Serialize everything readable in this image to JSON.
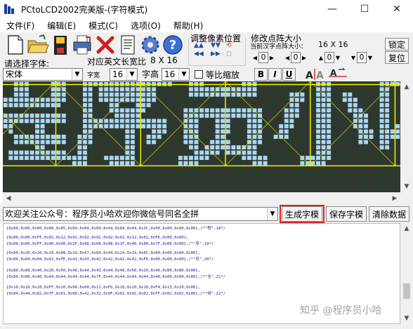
{
  "window": {
    "title": "PCtoLCD2002完美版-(字符模式)",
    "minimize": "—",
    "maximize": "☐",
    "close": "✕"
  },
  "menu": [
    "文件(F)",
    "编辑(E)",
    "模式(C)",
    "选项(O)",
    "帮助(H)"
  ],
  "toolbar": {
    "icons": [
      "new-file-icon",
      "open-folder-icon",
      "save-disk-icon",
      "print-icon",
      "delete-icon",
      "document-icon",
      "gear-icon",
      "help-icon"
    ],
    "adjust_label": "调整像素位置",
    "modify_label": "修改点阵大小",
    "current_size_label": "当前汉字点阵大小：",
    "current_size_value": "16 X 16",
    "lock_label": "锁定",
    "restore_label": "复位",
    "spin_values": [
      "0",
      "0",
      "0",
      "0"
    ],
    "select_font_label": "请选择字体:",
    "font_value": "宋体",
    "en_width_label": "对应英文长宽比",
    "en_width_value": "8 X 16",
    "char_width_label": "字宽",
    "char_width_value": "16",
    "char_height_label": "字高",
    "char_height_value": "16",
    "proportional_label": "等比缩放",
    "bold_label": "B",
    "italic_label": "I",
    "underline_label": "U"
  },
  "matrix": {
    "cols": 75,
    "rows": 21,
    "text": "程序员小哈"
  },
  "input_row": {
    "text": "欢迎关注公众号：程序员小哈欢迎你微信号同名全拼",
    "generate_label": "生成字模",
    "save_label": "保存字模",
    "clear_label": "清除数据"
  },
  "output": {
    "lines": [
      "{0x00,0x00,0x00,0x06,0x05,0x04,0x04,0x04,0x44,0x84,0x44,0x3C,0x00,0x00,0x00,0x00},/*\"程\",18*/",
      "{0x00,0x00,0xFE,0x02,0x12,0x92,0x92,0x92,0x92,0x92,0x12,0x02,0xFE,0x00,0x00},",
      "{0x00,0x00,0xFF,0x00,0x00,0x1F,0x08,0x08,0x08,0x1F,0x40,0x80,0x7F,0x00,0x00},/*\"序\",19*/",
      "{0x00,0x20,0x20,0x10,0x08,0x14,0x67,0x84,0x44,0x24,0x14,0x0C,0x00,0x00,0x00,0x00},",
      "{0x04,0x04,0x04,0x02,0xFE,0x43,0x43,0x42,0x42,0x42,0x42,0xFE,0x00,0x00,0x00},/*\"员\",20*/",
      "{0x80,0x80,0x40,0x20,0x50,0x48,0x44,0x43,0x44,0x48,0x50,0x20,0x40,0x80,0x80,0x00},",
      "{0x00,0x00,0x40,0x44,0x44,0x44,0x44,0x7F,0x44,0x44,0x44,0x44,0x40,0x00,0x00,0x00},/*\"全\",21*/",
      "{0x10,0x10,0x10,0xFF,0x10,0x90,0x00,0x11,0xF6,0x10,0x10,0x10,0xF4,0x13,0x10,0x00},",
      "{0x04,0x44,0x82,0x7F,0x01,0x80,0x42,0x32,0x0F,0x02,0x02,0x02,0xFF,0x02,0x02,0x00},/*\"拼\",22*/"
    ]
  },
  "watermark": "知乎 @程序员小哈",
  "colors": {
    "matrix_bg": "#333333",
    "dot_off": "#2b3b2b",
    "dot_on": "#a8d8ee",
    "grid_yellow": "#f2f200",
    "highlight": "#e02020"
  }
}
